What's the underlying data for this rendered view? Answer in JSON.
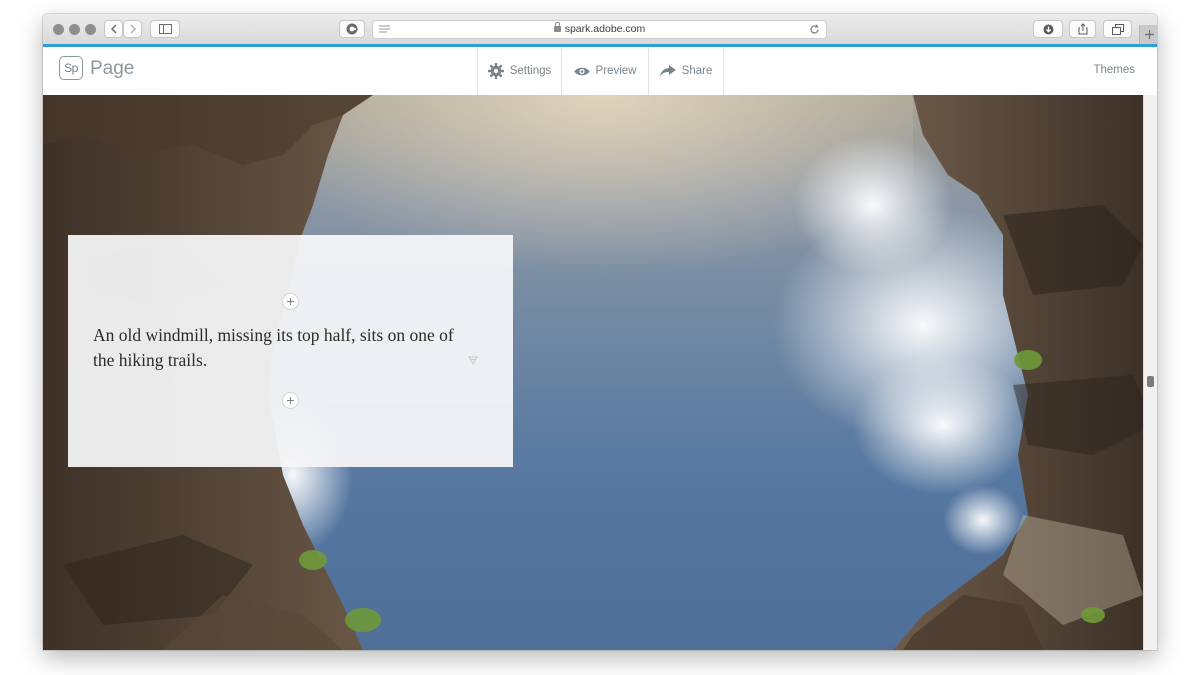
{
  "browser": {
    "url": "spark.adobe.com"
  },
  "header": {
    "logo_text": "Sp",
    "app_name": "Page",
    "settings_label": "Settings",
    "preview_label": "Preview",
    "share_label": "Share",
    "themes_label": "Themes"
  },
  "card": {
    "text": "An old windmill, missing its top half, sits on one of the hiking trails.",
    "add_symbol": "+"
  },
  "colors": {
    "accent": "#2f9fd8",
    "header_text": "#7a848b",
    "card_background": "#f5f5f7"
  }
}
